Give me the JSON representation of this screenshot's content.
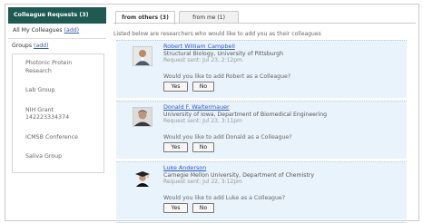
{
  "sidebar": {
    "header": "Colleague Requests (3)",
    "all_colleagues": "All My Colleagues",
    "all_colleagues_link": "(add)",
    "groups_label": "Groups",
    "groups_link": "(add)",
    "groups": [
      "Photonic Protein Research",
      "Lab Group",
      "NIH Grant 142223334374",
      "ICMSB Conference",
      "Saliva Group"
    ]
  },
  "tabs": {
    "from_others": "from others (3)",
    "from_me": "from me (1)"
  },
  "intro": "Listed below are researchers who would like to add you as their colleagues",
  "requests": [
    {
      "name": "Robert William Campbell",
      "affiliation": "Structural Biology, University of Pittsburgh",
      "sent": "Request sent: Jul 23, 2:12pm",
      "question": "Would you like to add Robert as a Colleague?",
      "yes": "Yes",
      "no": "No"
    },
    {
      "name": "Donald F. Waltermauer",
      "affiliation": "University of Iowa, Department of Biomedical Engineering",
      "sent": "Request sent: Jul 23, 3:11pm",
      "question": "Would you like to add Donald as a Colleague?",
      "yes": "Yes",
      "no": "No"
    },
    {
      "name": "Luke Anderson",
      "affiliation": "Carnegie Mellon University, Department of Chemistry",
      "sent": "Request sent: Jul 22, 3:12pm",
      "question": "Would you like to add Luke as a Colleague?",
      "yes": "Yes",
      "no": "No"
    }
  ],
  "colors": {
    "sidebar_header": "#1f5a52",
    "link": "#2f57c4",
    "card_bg": "#e9f3fb"
  },
  "icons": [
    "person-photo-icon",
    "person-photo-icon",
    "graduate-photo-icon"
  ]
}
